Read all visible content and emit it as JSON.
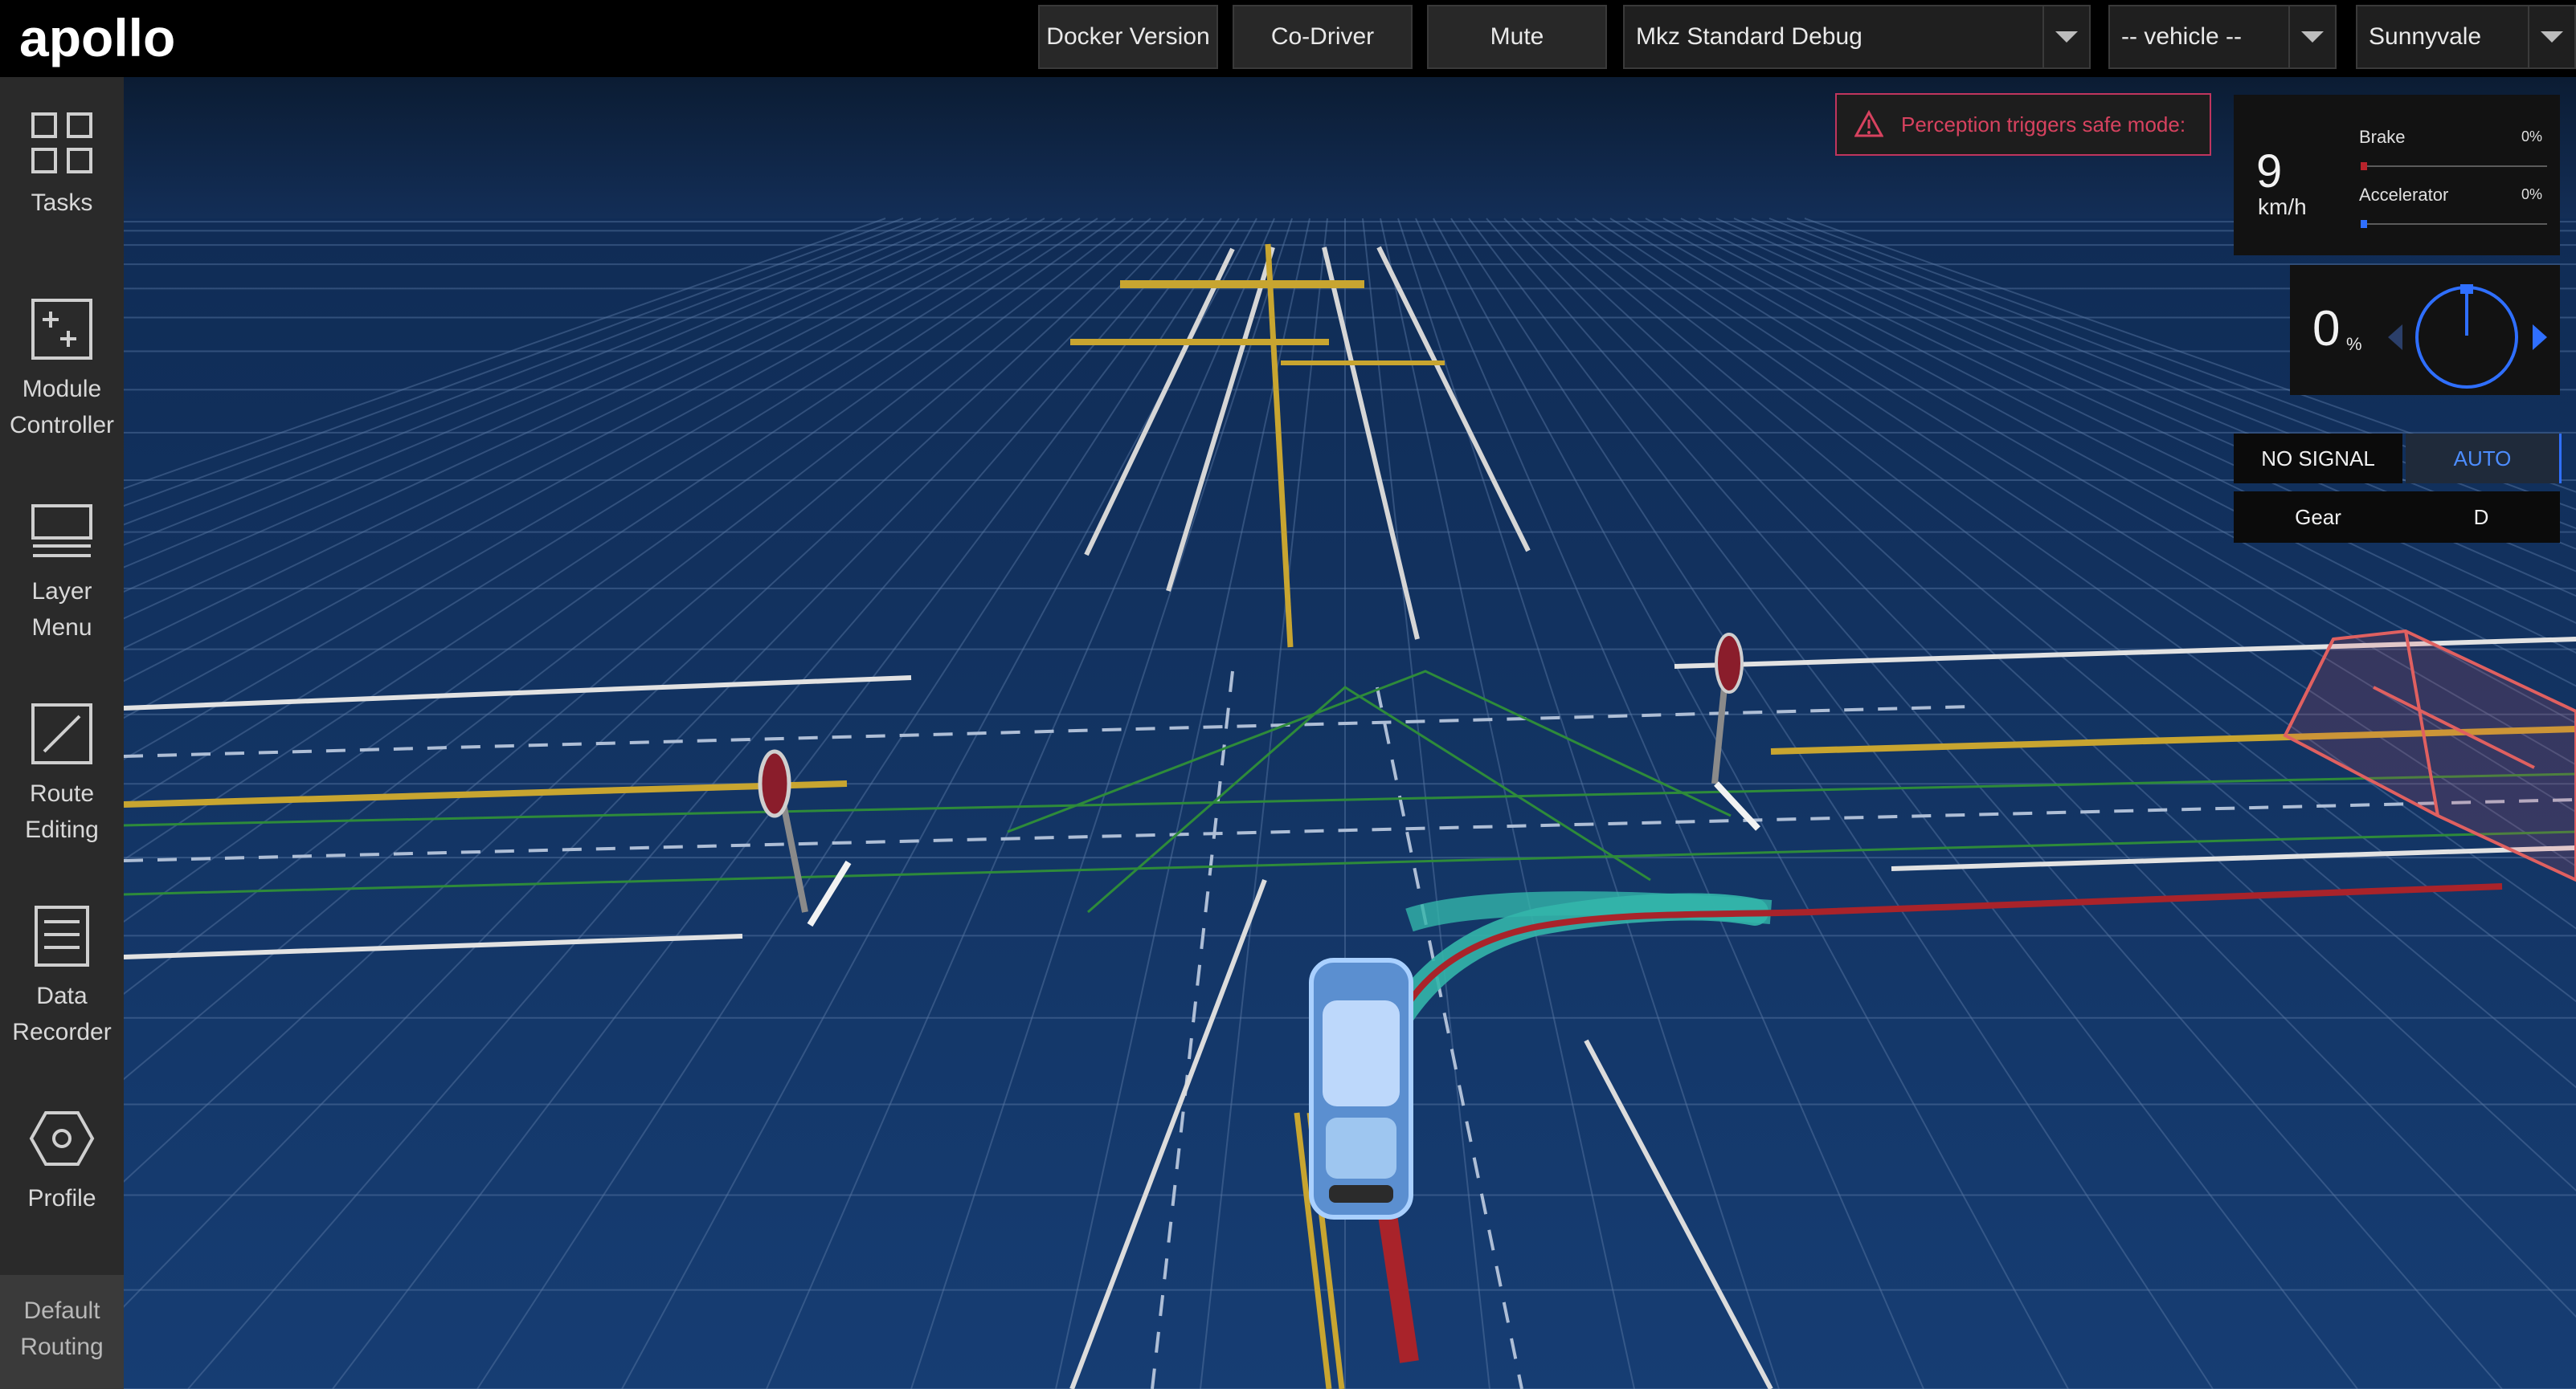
{
  "app": {
    "logo": "apollo"
  },
  "header": {
    "buttons": [
      "Docker Version",
      "Co-Driver",
      "Mute"
    ],
    "mode_select": "Mkz Standard Debug",
    "vehicle_select": "-- vehicle --",
    "map_select": "Sunnyvale"
  },
  "sidebar": {
    "items": [
      {
        "label_1": "Tasks",
        "label_2": "",
        "icon": "tasks-grid-icon"
      },
      {
        "label_1": "Module",
        "label_2": "Controller",
        "icon": "module-controller-icon"
      },
      {
        "label_1": "Layer",
        "label_2": "Menu",
        "icon": "layer-menu-icon"
      },
      {
        "label_1": "Route",
        "label_2": "Editing",
        "icon": "route-editing-icon"
      },
      {
        "label_1": "Data",
        "label_2": "Recorder",
        "icon": "data-recorder-icon"
      },
      {
        "label_1": "Profile",
        "label_2": "",
        "icon": "hexagon-profile-icon"
      }
    ],
    "bottom_item": {
      "label_1": "Default",
      "label_2": "Routing"
    }
  },
  "alert": {
    "text": "Perception triggers safe mode:",
    "icon": "warning-triangle-icon",
    "color": "#d7425f"
  },
  "dashboard": {
    "speed": {
      "value": "9",
      "unit": "km/h"
    },
    "brake": {
      "label": "Brake",
      "percent_text": "0%",
      "level": 0,
      "color": "#b8232b"
    },
    "accelerator": {
      "label": "Accelerator",
      "percent_text": "0%",
      "level": 0,
      "color": "#2f6fff"
    },
    "steering": {
      "value": "0",
      "unit": "%",
      "angle": 0
    },
    "signal": {
      "label": "NO SIGNAL"
    },
    "driving_mode": {
      "label": "AUTO",
      "color": "#4d8dff"
    },
    "gear": {
      "label": "Gear",
      "value": "D"
    }
  },
  "scene": {
    "background_color": "#102d58",
    "grid_color": "#5a7aa6",
    "yellow_line_color": "#c8a530",
    "path_color": "#33b5aa",
    "route_color": "#a9232a"
  }
}
